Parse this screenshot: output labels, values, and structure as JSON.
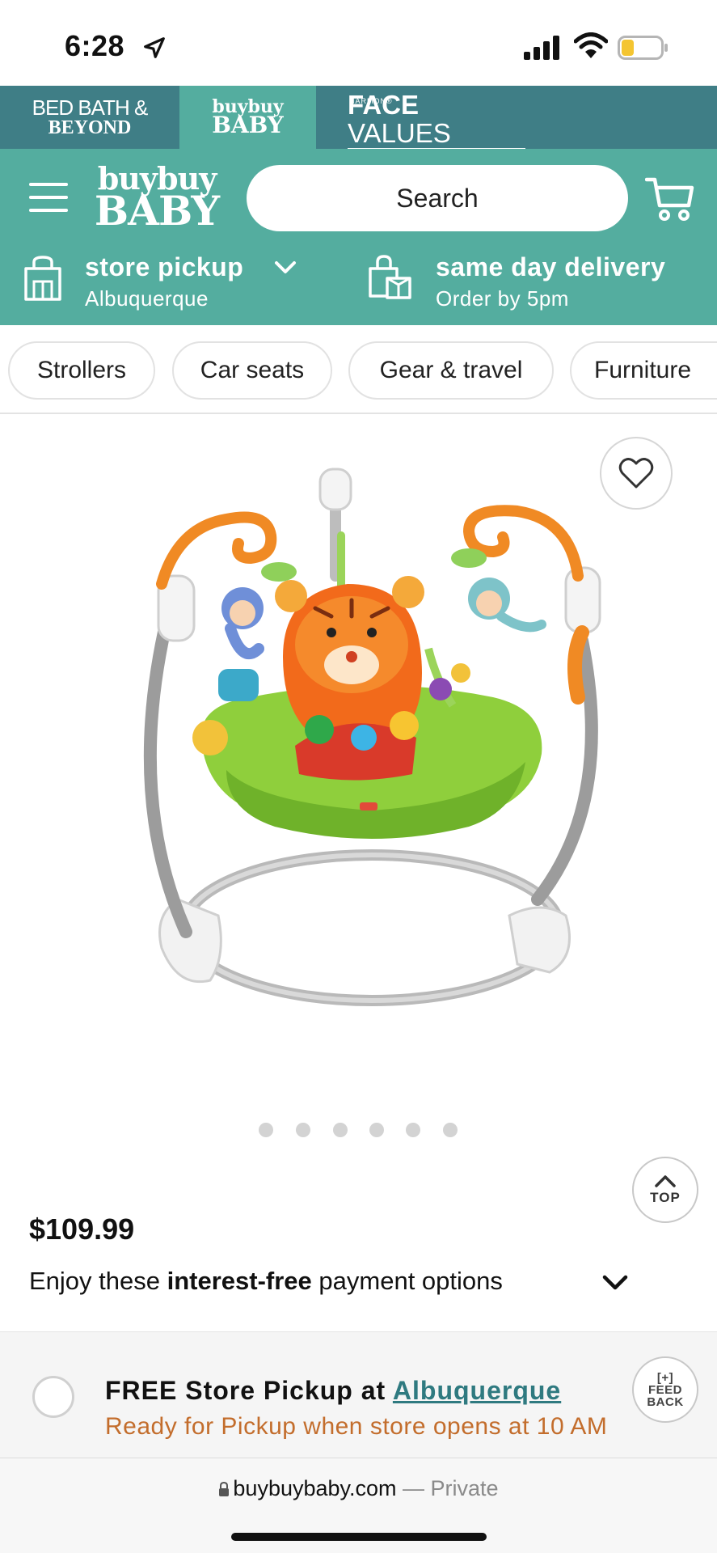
{
  "status_bar": {
    "time": "6:28"
  },
  "brand_tabs": {
    "bbb_line1": "BED BATH &",
    "bbb_line2": "BEYOND",
    "bbby_line1": "buybuy",
    "bbby_line2": "BABY",
    "fv_small": "HARMON®",
    "fv_bold": "FACE",
    "fv_light": "VALUES"
  },
  "header": {
    "logo_line1": "buybuy",
    "logo_line2": "BABY",
    "search_placeholder": "Search",
    "pickup_title": "store pickup",
    "pickup_store": "Albuquerque",
    "delivery_title": "same day delivery",
    "delivery_sub": "Order by 5pm"
  },
  "categories": [
    "Strollers",
    "Car seats",
    "Gear & travel",
    "Furniture"
  ],
  "product": {
    "image_dots": 6,
    "active_dot": 0,
    "top_label": "TOP",
    "price": "$109.99",
    "payment_pre": "Enjoy these ",
    "payment_bold": "interest-free",
    "payment_post": " payment options"
  },
  "pickup_option": {
    "title_pre": "FREE Store Pickup at ",
    "store_link": "Albuquerque",
    "subtitle": "Ready for Pickup when store opens at 10 AM",
    "feedback_line1": "[+]",
    "feedback_line2": "FEED",
    "feedback_line3": "BACK"
  },
  "url_bar": {
    "domain": "buybuybaby.com",
    "suffix": " — Private"
  },
  "colors": {
    "teal": "#54ad9f",
    "dark_teal": "#3f7e86",
    "link": "#2f7a80",
    "orange": "#c36d2c"
  }
}
